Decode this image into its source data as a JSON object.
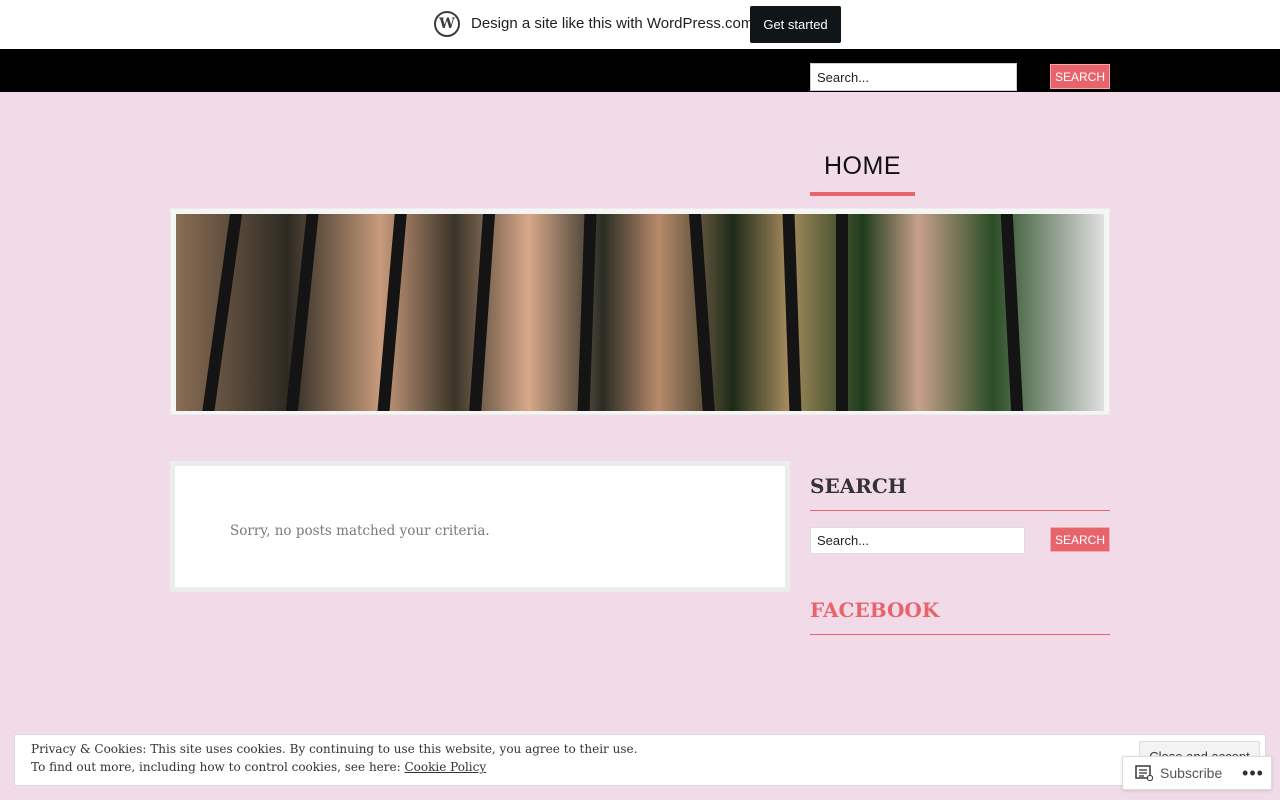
{
  "wp_bar": {
    "logo": "W",
    "text": "Design a site like this with WordPress.com",
    "cta": "Get started"
  },
  "top_search": {
    "value": "Search...",
    "button": "Search"
  },
  "nav": {
    "home": "HOME"
  },
  "main": {
    "no_posts": "Sorry, no posts matched your criteria."
  },
  "sidebar": {
    "search_title": "SEARCH",
    "search_value": "Search...",
    "search_button": "Search",
    "facebook_title": "FACEBOOK"
  },
  "cookie": {
    "line1": "Privacy & Cookies: This site uses cookies. By continuing to use this website, you agree to their use.",
    "line2_prefix": "To find out more, including how to control cookies, see here:",
    "link": "Cookie Policy",
    "close": "Close and accept"
  },
  "subscribe": {
    "label": "Subscribe",
    "more": "•••"
  },
  "colors": {
    "background": "#f2dbe8",
    "accent": "#e8646d",
    "top_strip": "#000000"
  }
}
